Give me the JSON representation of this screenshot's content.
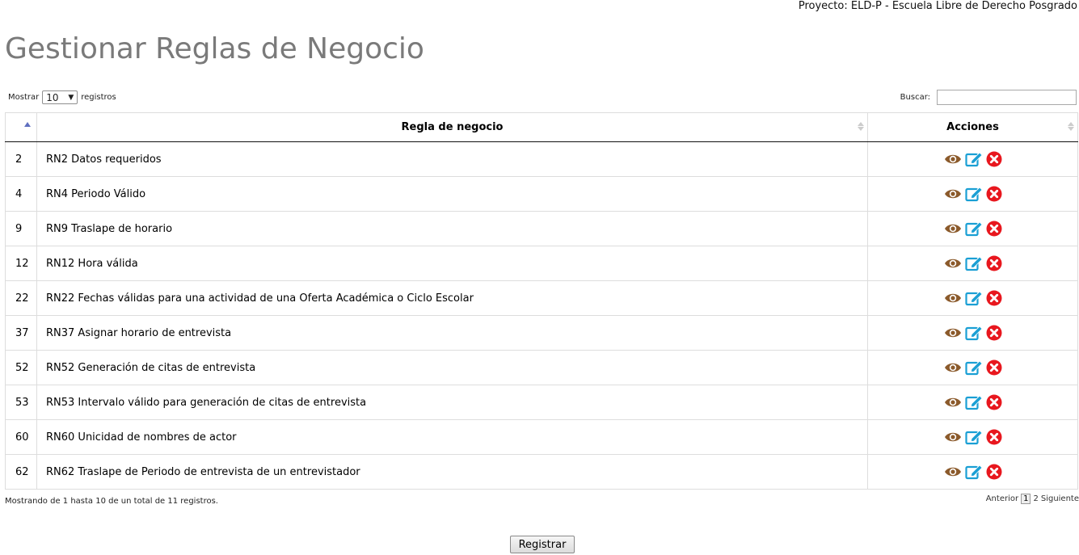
{
  "project_label": "Proyecto: ELD-P - Escuela Libre de Derecho Posgrado",
  "page_title": "Gestionar Reglas de Negocio",
  "length": {
    "prefix": "Mostrar",
    "value": "10",
    "suffix": "registros"
  },
  "search": {
    "label": "Buscar:",
    "value": ""
  },
  "table": {
    "headers": {
      "id": "",
      "rule": "Regla de negocio",
      "actions": "Acciones"
    },
    "rows": [
      {
        "id": "2",
        "name": "RN2 Datos requeridos"
      },
      {
        "id": "4",
        "name": "RN4 Periodo Válido"
      },
      {
        "id": "9",
        "name": "RN9 Traslape de horario"
      },
      {
        "id": "12",
        "name": "RN12 Hora válida"
      },
      {
        "id": "22",
        "name": "RN22 Fechas válidas para una actividad de una Oferta Académica o Ciclo Escolar"
      },
      {
        "id": "37",
        "name": "RN37 Asignar horario de entrevista"
      },
      {
        "id": "52",
        "name": "RN52 Generación de citas de entrevista"
      },
      {
        "id": "53",
        "name": "RN53 Intervalo válido para generación de citas de entrevista"
      },
      {
        "id": "60",
        "name": "RN60 Unicidad de nombres de actor"
      },
      {
        "id": "62",
        "name": "RN62 Traslape de Periodo de entrevista de un entrevistador"
      }
    ],
    "action_icons": [
      "eye-icon",
      "edit-icon",
      "delete-icon"
    ]
  },
  "info": "Mostrando de 1 hasta 10 de un total de 11 registros.",
  "pagination": {
    "prev": "Anterior",
    "pages": [
      "1",
      "2"
    ],
    "current": "1",
    "next": "Siguiente"
  },
  "register_button": "Registrar",
  "colors": {
    "eye": "#8b5a2b",
    "edit": "#1a9fd4",
    "delete": "#e8171e",
    "title": "#7a7a7a"
  }
}
